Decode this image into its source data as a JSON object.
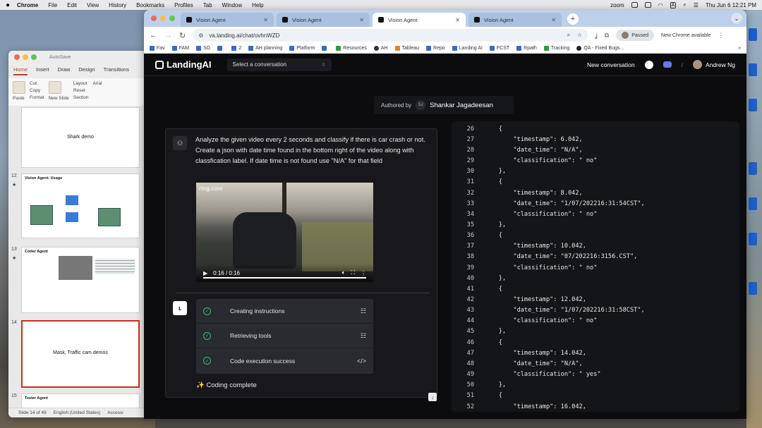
{
  "menubar": {
    "apple": "",
    "app": "Chrome",
    "items": [
      "File",
      "Edit",
      "View",
      "History",
      "Bookmarks",
      "Profiles",
      "Tab",
      "Window",
      "Help"
    ],
    "zoom": "zoom",
    "a_badge": "A",
    "datetime": "Thu Jun 6  12:21 PM"
  },
  "powerpoint": {
    "autosave": "AutoSave",
    "tabs": [
      "Home",
      "Insert",
      "Draw",
      "Design",
      "Transitions"
    ],
    "ribbon": {
      "paste": "Paste",
      "cut": "Cut",
      "copy": "Copy",
      "format": "Format",
      "new_slide": "New Slide",
      "layout": "Layout",
      "reset": "Reset",
      "section": "Section",
      "font": "Arial"
    },
    "slides": [
      {
        "num": "",
        "title": "",
        "center": "Shark demo",
        "selected": false
      },
      {
        "num": "12",
        "title": "Vision Agent: Usage",
        "center": "",
        "selected": false
      },
      {
        "num": "13",
        "title": "Coder Agent",
        "center": "",
        "selected": false
      },
      {
        "num": "14",
        "title": "",
        "center": "Mask, Traffic cam demos",
        "selected": true
      },
      {
        "num": "15",
        "title": "Tester Agent",
        "center": "",
        "selected": false
      }
    ],
    "status": {
      "slide": "Slide 14 of 49",
      "lang": "English (United States)",
      "access": "Accessi"
    }
  },
  "chrome": {
    "tabs": [
      {
        "title": "Vision Agent",
        "active": false
      },
      {
        "title": "Vision Agent",
        "active": false
      },
      {
        "title": "Vision Agent",
        "active": true
      },
      {
        "title": "Vision Agent",
        "active": false
      }
    ],
    "url": "va.landing.ai/chat/ovhnWZD",
    "paused": "Paused",
    "new_chrome": "New Chrome available",
    "bookmarks": [
      "Fav",
      "FAM",
      "SG",
      "",
      "2",
      "AH planning",
      "Platform",
      "",
      "Resources",
      "AH",
      "Tableau",
      "Repo",
      "Landing AI",
      "FCST",
      "Rpath",
      "Tracking",
      "QA - Fixed Bugs..."
    ]
  },
  "app": {
    "logo": "LandingAI",
    "select_placeholder": "Select a conversation",
    "new_conversation": "New conversation",
    "user": "Andrew Ng",
    "authored_by": "Authored by",
    "author_initials": "SJ",
    "author_name": "Shankar Jagadeesan",
    "prompt": "Analyze the given video every 2 seconds and classify if there is car crash or not. Create a json with date time found in the bottom right of the video along with classfication label. If date time is not found use \"N/A\" for that field",
    "video": {
      "watermark": "ring.com",
      "time": "0:16 / 0:16",
      "progress": 1.0
    },
    "steps": [
      {
        "label": "Creating instructions",
        "action_icon": "list-icon"
      },
      {
        "label": "Retrieving tools",
        "action_icon": "list-icon"
      },
      {
        "label": "Code execution success",
        "action_icon": "code-icon"
      }
    ],
    "coding_complete": "✨ Coding complete"
  },
  "code_lines": [
    {
      "n": "26",
      "t": "    {"
    },
    {
      "n": "27",
      "t": "        \"timestamp\": 6.042,"
    },
    {
      "n": "28",
      "t": "        \"date_time\": \"N/A\","
    },
    {
      "n": "29",
      "t": "        \"classification\": \" no\""
    },
    {
      "n": "30",
      "t": "    },"
    },
    {
      "n": "31",
      "t": "    {"
    },
    {
      "n": "32",
      "t": "        \"timestamp\": 8.042,"
    },
    {
      "n": "33",
      "t": "        \"date_time\": \"1/07/202216:31:54CST\","
    },
    {
      "n": "34",
      "t": "        \"classification\": \" no\""
    },
    {
      "n": "35",
      "t": "    },"
    },
    {
      "n": "36",
      "t": "    {"
    },
    {
      "n": "37",
      "t": "        \"timestamp\": 10.042,"
    },
    {
      "n": "38",
      "t": "        \"date_time\": \"07/202216:3156.CST\","
    },
    {
      "n": "39",
      "t": "        \"classification\": \" no\""
    },
    {
      "n": "40",
      "t": "    },"
    },
    {
      "n": "41",
      "t": "    {"
    },
    {
      "n": "42",
      "t": "        \"timestamp\": 12.042,"
    },
    {
      "n": "43",
      "t": "        \"date_time\": \"1/07/202216:31:58CST\","
    },
    {
      "n": "44",
      "t": "        \"classification\": \" no\""
    },
    {
      "n": "45",
      "t": "    },"
    },
    {
      "n": "46",
      "t": "    {"
    },
    {
      "n": "47",
      "t": "        \"timestamp\": 14.042,"
    },
    {
      "n": "48",
      "t": "        \"date_time\": \"N/A\","
    },
    {
      "n": "49",
      "t": "        \"classification\": \" yes\""
    },
    {
      "n": "50",
      "t": "    },"
    },
    {
      "n": "51",
      "t": "    {"
    },
    {
      "n": "52",
      "t": "        \"timestamp\": 16.042,"
    }
  ]
}
